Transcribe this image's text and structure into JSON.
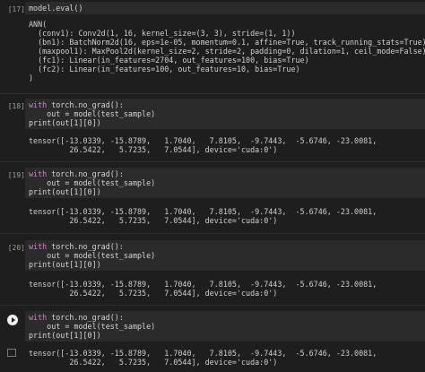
{
  "cell17": {
    "label": "[17]",
    "code": [
      "model.eval()"
    ],
    "output": [
      "ANN(",
      "  (conv1): Conv2d(1, 16, kernel_size=(3, 3), stride=(1, 1))",
      "  (bn1): BatchNorm2d(16, eps=1e-05, momentum=0.1, affine=True, track_running_stats=True)",
      "  (maxpool1): MaxPool2d(kernel_size=2, stride=2, padding=0, dilation=1, ceil_mode=False)",
      "  (fc1): Linear(in_features=2704, out_features=100, bias=True)",
      "  (fc2): Linear(in_features=100, out_features=10, bias=True)",
      ")"
    ]
  },
  "cell18": {
    "label": "[18]",
    "code": [
      "with torch.no_grad():",
      "    out = model(test_sample)",
      "print(out[1][0])"
    ],
    "output": [
      "tensor([-13.0339, -15.8789,   1.7040,   7.8105,  -9.7443,  -5.6746, -23.0081,",
      "         26.5422,   5.7235,   7.0544], device='cuda:0')"
    ]
  },
  "cell19": {
    "label": "[19]",
    "code": [
      "with torch.no_grad():",
      "    out = model(test_sample)",
      "print(out[1][0])"
    ],
    "output": [
      "tensor([-13.0339, -15.8789,   1.7040,   7.8105,  -9.7443,  -5.6746, -23.0081,",
      "         26.5422,   5.7235,   7.0544], device='cuda:0')"
    ]
  },
  "cell20": {
    "label": "[20]",
    "code": [
      "with torch.no_grad():",
      "    out = model(test_sample)",
      "print(out[1][0])"
    ],
    "output": [
      "tensor([-13.0339, -15.8789,   1.7040,   7.8105,  -9.7443,  -5.6746, -23.0081,",
      "         26.5422,   5.7235,   7.0544], device='cuda:0')"
    ]
  },
  "cell_active": {
    "code": [
      "with torch.no_grad():",
      "    out = model(test_sample)",
      "print(out[1][0])"
    ],
    "output": [
      "tensor([-13.0339, -15.8789,   1.7040,   7.8105,  -9.7443,  -5.6746, -23.0081,",
      "         26.5422,   5.7235,   7.0544], device='cuda:0')"
    ]
  }
}
